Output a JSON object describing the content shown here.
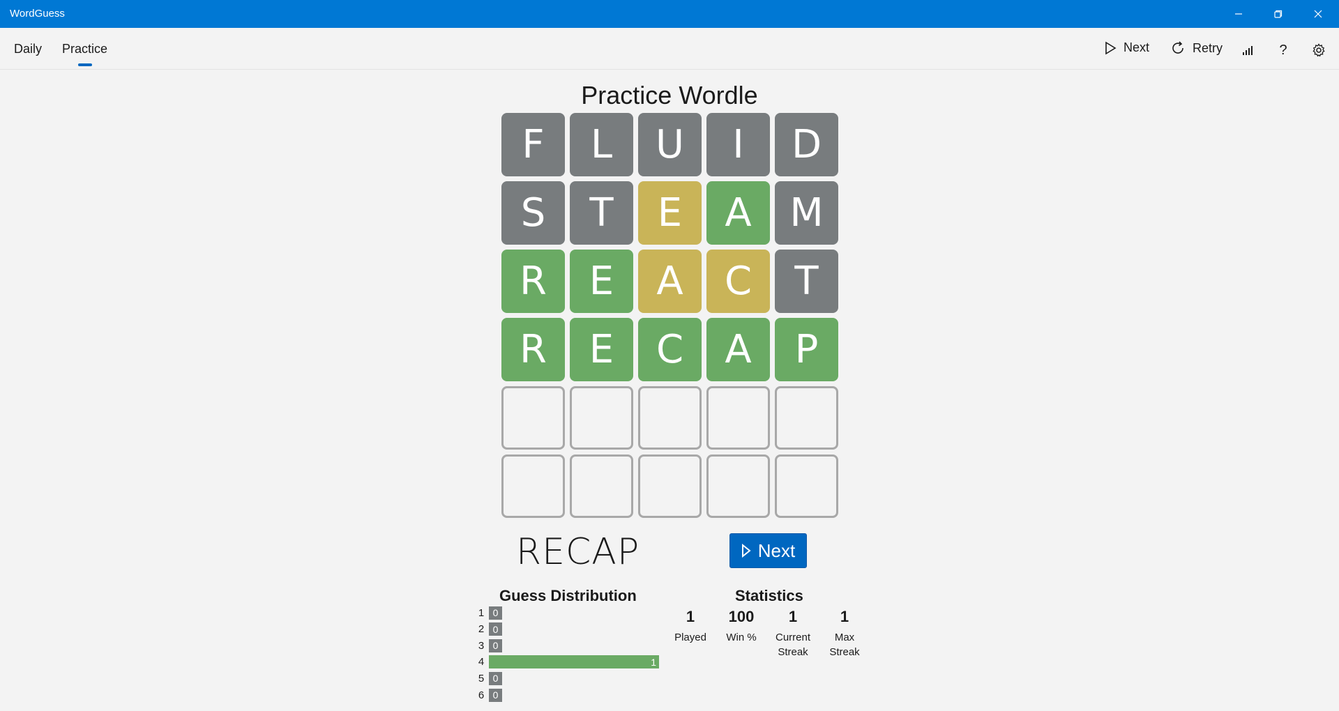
{
  "window": {
    "title": "WordGuess"
  },
  "nav": {
    "tabs": [
      {
        "label": "Daily"
      },
      {
        "label": "Practice"
      }
    ],
    "active_tab": "Practice"
  },
  "toolbar": {
    "next_label": "Next",
    "retry_label": "Retry",
    "help_glyph": "?"
  },
  "game": {
    "title": "Practice Wordle",
    "board": [
      [
        {
          "letter": "F",
          "state": "absent"
        },
        {
          "letter": "L",
          "state": "absent"
        },
        {
          "letter": "U",
          "state": "absent"
        },
        {
          "letter": "I",
          "state": "absent"
        },
        {
          "letter": "D",
          "state": "absent"
        }
      ],
      [
        {
          "letter": "S",
          "state": "absent"
        },
        {
          "letter": "T",
          "state": "absent"
        },
        {
          "letter": "E",
          "state": "present"
        },
        {
          "letter": "A",
          "state": "correct"
        },
        {
          "letter": "M",
          "state": "absent"
        }
      ],
      [
        {
          "letter": "R",
          "state": "correct"
        },
        {
          "letter": "E",
          "state": "correct"
        },
        {
          "letter": "A",
          "state": "present"
        },
        {
          "letter": "C",
          "state": "present"
        },
        {
          "letter": "T",
          "state": "absent"
        }
      ],
      [
        {
          "letter": "R",
          "state": "correct"
        },
        {
          "letter": "E",
          "state": "correct"
        },
        {
          "letter": "C",
          "state": "correct"
        },
        {
          "letter": "A",
          "state": "correct"
        },
        {
          "letter": "P",
          "state": "correct"
        }
      ],
      [
        {
          "letter": "",
          "state": "empty"
        },
        {
          "letter": "",
          "state": "empty"
        },
        {
          "letter": "",
          "state": "empty"
        },
        {
          "letter": "",
          "state": "empty"
        },
        {
          "letter": "",
          "state": "empty"
        }
      ],
      [
        {
          "letter": "",
          "state": "empty"
        },
        {
          "letter": "",
          "state": "empty"
        },
        {
          "letter": "",
          "state": "empty"
        },
        {
          "letter": "",
          "state": "empty"
        },
        {
          "letter": "",
          "state": "empty"
        }
      ]
    ],
    "answer": "RECAP",
    "next_button_label": "Next"
  },
  "distribution": {
    "title": "Guess Distribution",
    "rows": [
      {
        "guess": "1",
        "count": 0
      },
      {
        "guess": "2",
        "count": 0
      },
      {
        "guess": "3",
        "count": 0
      },
      {
        "guess": "4",
        "count": 1
      },
      {
        "guess": "5",
        "count": 0
      },
      {
        "guess": "6",
        "count": 0
      }
    ]
  },
  "statistics": {
    "title": "Statistics",
    "items": [
      {
        "value": "1",
        "label": "Played"
      },
      {
        "value": "100",
        "label": "Win %"
      },
      {
        "value": "1",
        "label": "Current Streak"
      },
      {
        "value": "1",
        "label": "Max Streak"
      }
    ]
  },
  "colors": {
    "titlebar": "#0078d4",
    "accent": "#0067c0",
    "absent": "#787c7e",
    "present": "#c9b458",
    "correct": "#6aaa64"
  }
}
